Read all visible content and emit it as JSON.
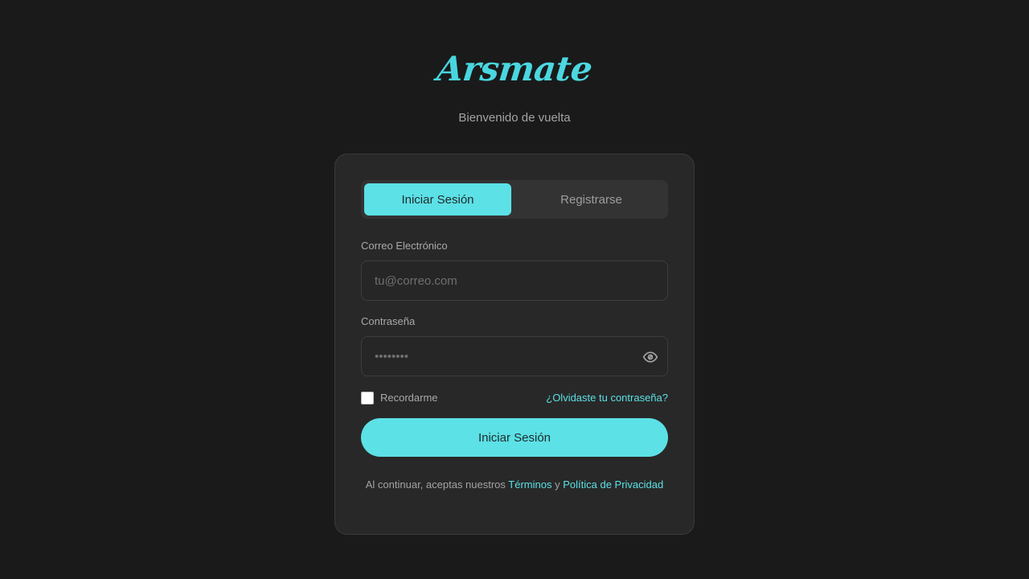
{
  "brand": {
    "logo_text": "Arsmate",
    "accent_color": "#5ce1e6"
  },
  "header": {
    "subtitle": "Bienvenido de vuelta"
  },
  "tabs": [
    {
      "label": "Iniciar Sesión",
      "active": true
    },
    {
      "label": "Registrarse",
      "active": false
    }
  ],
  "form": {
    "email": {
      "label": "Correo Electrónico",
      "placeholder": "tu@correo.com",
      "value": ""
    },
    "password": {
      "label": "Contraseña",
      "placeholder": "••••••••",
      "value": "",
      "toggle_icon": "eye-icon"
    },
    "remember": {
      "label": "Recordarme",
      "checked": false
    },
    "forgot_link": "¿Olvidaste tu contraseña?",
    "submit_label": "Iniciar Sesión"
  },
  "footer": {
    "prefix": "Al continuar, aceptas nuestros ",
    "terms_link": "Términos",
    "conjunction": " y ",
    "privacy_link": "Política de Privacidad"
  }
}
